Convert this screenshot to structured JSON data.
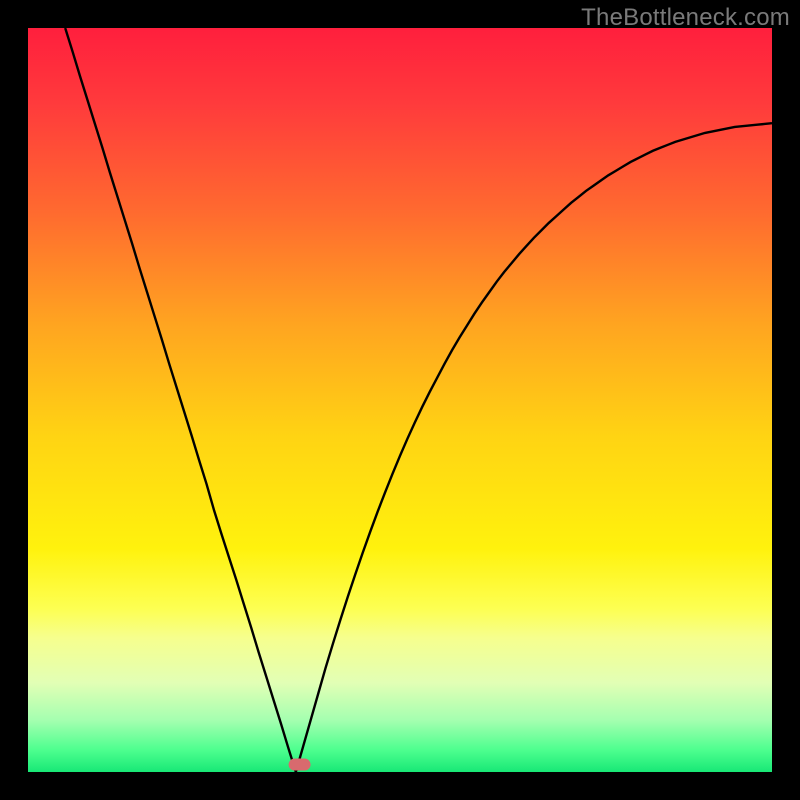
{
  "watermark": "TheBottleneck.com",
  "chart_data": {
    "type": "line",
    "title": "",
    "xlabel": "",
    "ylabel": "",
    "xlim": [
      0,
      100
    ],
    "ylim": [
      0,
      100
    ],
    "x": [
      5,
      6,
      7,
      8,
      9,
      10,
      11,
      12,
      13,
      14,
      15,
      16,
      17,
      18,
      19,
      20,
      21,
      22,
      23,
      24,
      25,
      26,
      27,
      28,
      29,
      30,
      31,
      32,
      33,
      34,
      35,
      36,
      37,
      38,
      39,
      40,
      41,
      42,
      43,
      44,
      45,
      46,
      47,
      48,
      49,
      50,
      51,
      52,
      53,
      54,
      55,
      56,
      57,
      58,
      59,
      60,
      61,
      62,
      63,
      64,
      65,
      66,
      67,
      68,
      69,
      70,
      71,
      72,
      73,
      74,
      75,
      76,
      77,
      78,
      79,
      80,
      81,
      82,
      83,
      84,
      85,
      86,
      87,
      88,
      89,
      90,
      91,
      92,
      93,
      94,
      95,
      96,
      97,
      98,
      99,
      100
    ],
    "y": [
      100,
      96.8,
      93.5,
      90.3,
      87.1,
      83.9,
      80.6,
      77.4,
      74.2,
      71.0,
      67.7,
      64.5,
      61.3,
      58.1,
      54.8,
      51.6,
      48.4,
      45.2,
      41.9,
      38.7,
      35.2,
      32.0,
      28.9,
      25.8,
      22.6,
      19.4,
      16.1,
      12.9,
      9.7,
      6.5,
      3.2,
      0.0,
      3.5,
      7.0,
      10.5,
      14.0,
      17.3,
      20.5,
      23.6,
      26.6,
      29.5,
      32.3,
      35.0,
      37.6,
      40.1,
      42.5,
      44.8,
      47.0,
      49.1,
      51.1,
      53.0,
      54.9,
      56.7,
      58.4,
      60.0,
      61.6,
      63.1,
      64.5,
      65.9,
      67.2,
      68.4,
      69.6,
      70.7,
      71.8,
      72.8,
      73.8,
      74.7,
      75.6,
      76.5,
      77.3,
      78.1,
      78.8,
      79.5,
      80.2,
      80.8,
      81.4,
      82.0,
      82.5,
      83.0,
      83.5,
      83.9,
      84.3,
      84.7,
      85.0,
      85.3,
      85.6,
      85.9,
      86.1,
      86.3,
      86.5,
      86.7,
      86.8,
      86.9,
      87.0,
      87.1,
      87.2
    ],
    "marker": {
      "x": 36.5,
      "y": 1.0
    },
    "gradient_stops": [
      {
        "pos": 0.0,
        "color": "#ff1f3d"
      },
      {
        "pos": 0.1,
        "color": "#ff3a3c"
      },
      {
        "pos": 0.25,
        "color": "#ff6b2f"
      },
      {
        "pos": 0.4,
        "color": "#ffa520"
      },
      {
        "pos": 0.55,
        "color": "#ffd413"
      },
      {
        "pos": 0.7,
        "color": "#fff20d"
      },
      {
        "pos": 0.78,
        "color": "#fdff52"
      },
      {
        "pos": 0.82,
        "color": "#f6ff8e"
      },
      {
        "pos": 0.88,
        "color": "#e2ffb5"
      },
      {
        "pos": 0.93,
        "color": "#a5ffb0"
      },
      {
        "pos": 0.97,
        "color": "#4eff8f"
      },
      {
        "pos": 1.0,
        "color": "#18e876"
      }
    ]
  }
}
